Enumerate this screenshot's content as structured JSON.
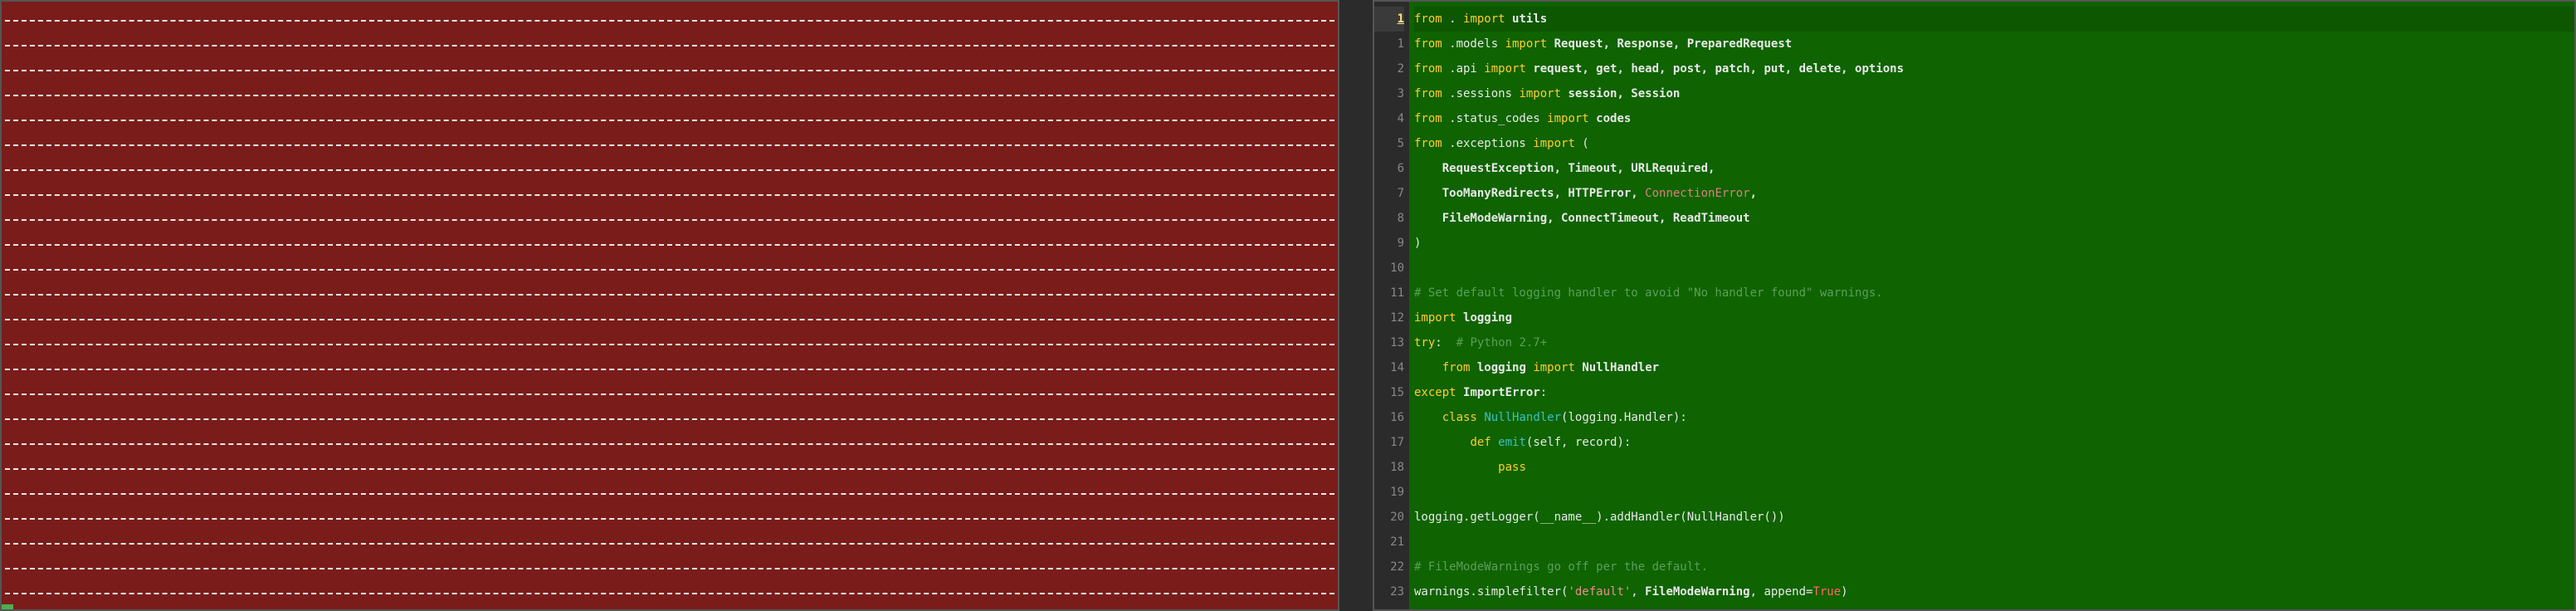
{
  "left": {
    "rows": 24
  },
  "right": {
    "primary_line": "1",
    "lines": [
      {
        "n": "1",
        "tokens": [
          [
            "kw",
            "from"
          ],
          [
            "",
            " . "
          ],
          [
            "kw",
            "import"
          ],
          [
            "",
            " "
          ],
          [
            "id",
            "utils"
          ]
        ]
      },
      {
        "n": "1",
        "tokens": [
          [
            "kw",
            "from"
          ],
          [
            "",
            " .models "
          ],
          [
            "kw",
            "import"
          ],
          [
            "",
            " "
          ],
          [
            "id",
            "Request, Response, PreparedRequest"
          ]
        ]
      },
      {
        "n": "2",
        "tokens": [
          [
            "kw",
            "from"
          ],
          [
            "",
            " .api "
          ],
          [
            "kw",
            "import"
          ],
          [
            "",
            " "
          ],
          [
            "id",
            "request, get, head, post, patch, put, delete, options"
          ]
        ]
      },
      {
        "n": "3",
        "tokens": [
          [
            "kw",
            "from"
          ],
          [
            "",
            " .sessions "
          ],
          [
            "kw",
            "import"
          ],
          [
            "",
            " "
          ],
          [
            "id",
            "session, Session"
          ]
        ]
      },
      {
        "n": "4",
        "tokens": [
          [
            "kw",
            "from"
          ],
          [
            "",
            " .status_codes "
          ],
          [
            "kw",
            "import"
          ],
          [
            "",
            " "
          ],
          [
            "id",
            "codes"
          ]
        ]
      },
      {
        "n": "5",
        "tokens": [
          [
            "kw",
            "from"
          ],
          [
            "",
            " .exceptions "
          ],
          [
            "kw",
            "import"
          ],
          [
            "",
            " ("
          ]
        ]
      },
      {
        "n": "6",
        "tokens": [
          [
            "",
            "    "
          ],
          [
            "id",
            "RequestException, Timeout, URLRequired,"
          ]
        ]
      },
      {
        "n": "7",
        "tokens": [
          [
            "",
            "    "
          ],
          [
            "id",
            "TooManyRedirects, HTTPError, "
          ],
          [
            "exc",
            "ConnectionError"
          ],
          [
            "id",
            ","
          ]
        ]
      },
      {
        "n": "8",
        "tokens": [
          [
            "",
            "    "
          ],
          [
            "id",
            "FileModeWarning, ConnectTimeout, ReadTimeout"
          ]
        ]
      },
      {
        "n": "9",
        "tokens": [
          [
            "",
            ")"
          ]
        ]
      },
      {
        "n": "10",
        "tokens": []
      },
      {
        "n": "11",
        "tokens": [
          [
            "cmt",
            "# Set default logging handler to avoid \"No handler found\" warnings."
          ]
        ]
      },
      {
        "n": "12",
        "tokens": [
          [
            "kw",
            "import"
          ],
          [
            "",
            " "
          ],
          [
            "id",
            "logging"
          ]
        ]
      },
      {
        "n": "13",
        "tokens": [
          [
            "kw",
            "try"
          ],
          [
            "",
            ":  "
          ],
          [
            "cmt",
            "# Python 2.7+"
          ]
        ]
      },
      {
        "n": "14",
        "tokens": [
          [
            "",
            "    "
          ],
          [
            "kw",
            "from"
          ],
          [
            "",
            " "
          ],
          [
            "id",
            "logging"
          ],
          [
            "",
            " "
          ],
          [
            "kw",
            "import"
          ],
          [
            "",
            " "
          ],
          [
            "id",
            "NullHandler"
          ]
        ]
      },
      {
        "n": "15",
        "tokens": [
          [
            "kw",
            "except"
          ],
          [
            "",
            " "
          ],
          [
            "id",
            "ImportError"
          ],
          [
            "",
            ":"
          ]
        ]
      },
      {
        "n": "16",
        "tokens": [
          [
            "",
            "    "
          ],
          [
            "kw",
            "class"
          ],
          [
            "",
            " "
          ],
          [
            "type",
            "NullHandler"
          ],
          [
            "",
            "(logging.Handler):"
          ]
        ]
      },
      {
        "n": "17",
        "tokens": [
          [
            "",
            "        "
          ],
          [
            "kw",
            "def"
          ],
          [
            "",
            " "
          ],
          [
            "type",
            "emit"
          ],
          [
            "",
            "(self, record):"
          ]
        ]
      },
      {
        "n": "18",
        "tokens": [
          [
            "",
            "            "
          ],
          [
            "kw",
            "pass"
          ]
        ]
      },
      {
        "n": "19",
        "tokens": []
      },
      {
        "n": "20",
        "tokens": [
          [
            "",
            "logging.getLogger(__name__).addHandler(NullHandler())"
          ]
        ]
      },
      {
        "n": "21",
        "tokens": []
      },
      {
        "n": "22",
        "tokens": [
          [
            "cmt",
            "# FileModeWarnings go off per the default."
          ]
        ]
      },
      {
        "n": "23",
        "tokens": [
          [
            "",
            "warnings.simplefilter("
          ],
          [
            "str",
            "'default'"
          ],
          [
            "",
            ", "
          ],
          [
            "id",
            "FileModeWarning"
          ],
          [
            "",
            ", append="
          ],
          [
            "builtin",
            "True"
          ],
          [
            "",
            ")"
          ]
        ]
      }
    ]
  }
}
